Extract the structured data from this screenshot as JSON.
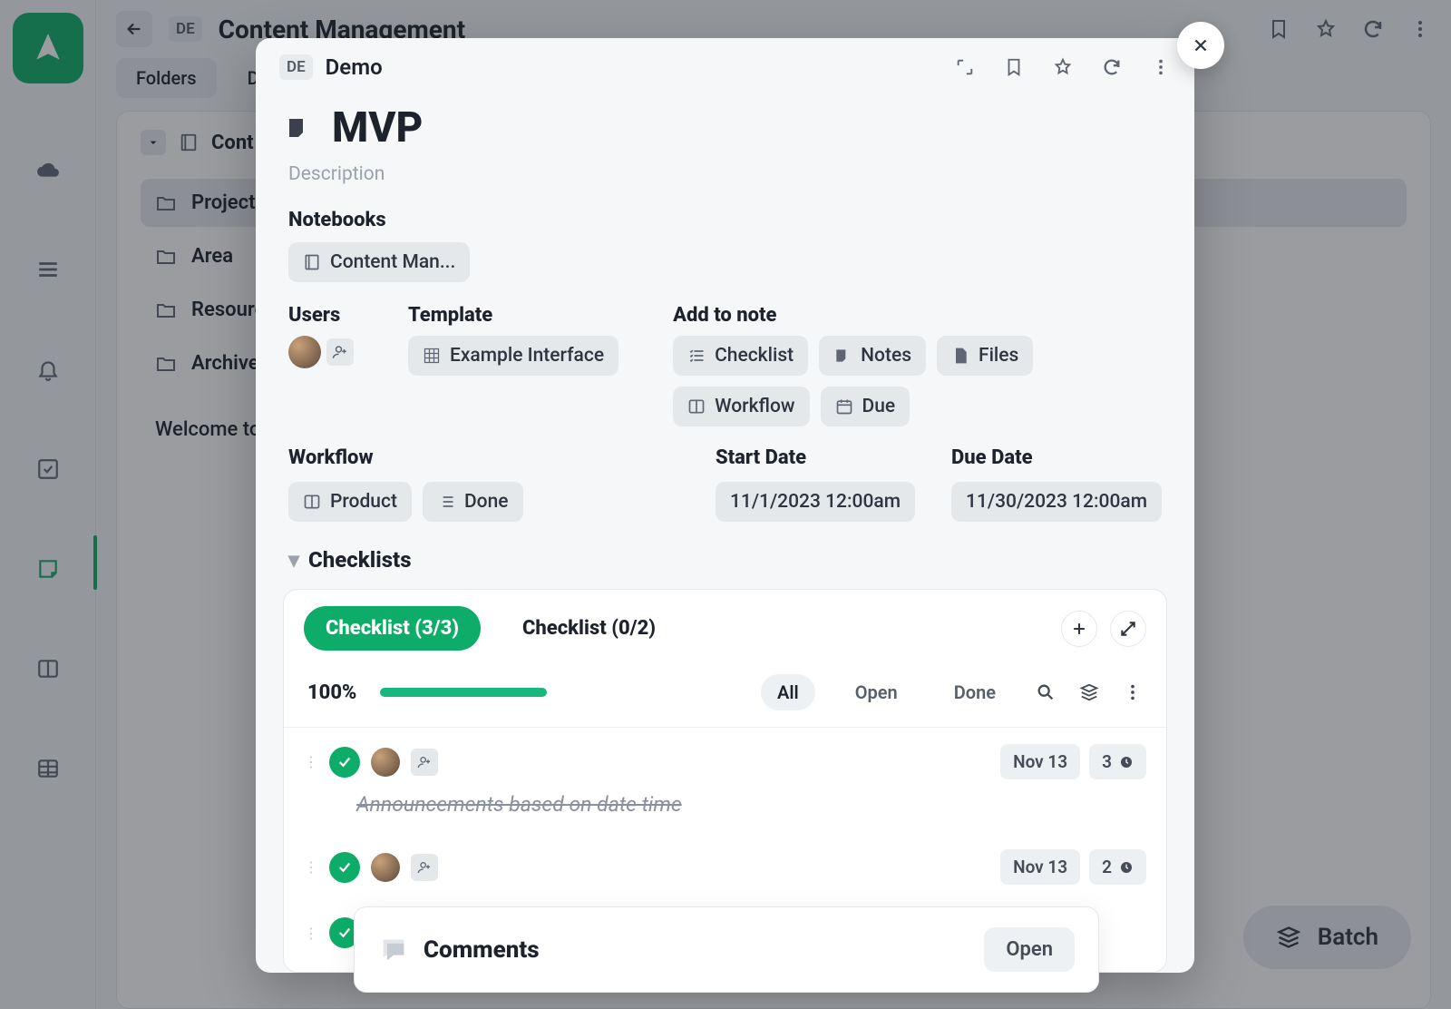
{
  "workspace_tag": "DE",
  "page_title": "Content Management",
  "tabs": {
    "folders": "Folders",
    "data": "Da"
  },
  "breadcrumb": "Cont",
  "sidebar_nav": {
    "projects": "Projects",
    "area": "Area",
    "resources": "Resourc",
    "archive": "Archive"
  },
  "welcome": "Welcome to",
  "batch_label": "Batch",
  "modal": {
    "workspace_tag": "DE",
    "workspace_name": "Demo",
    "title": "MVP",
    "description_placeholder": "Description",
    "labels": {
      "notebooks": "Notebooks",
      "users": "Users",
      "template": "Template",
      "add_to_note": "Add to note",
      "workflow": "Workflow",
      "start_date": "Start Date",
      "due_date": "Due Date",
      "checklists": "Checklists"
    },
    "notebook_chip": "Content Man...",
    "template_chip": "Example Interface",
    "add_chips": {
      "checklist": "Checklist",
      "notes": "Notes",
      "files": "Files",
      "workflow": "Workflow",
      "due": "Due"
    },
    "workflow_chips": {
      "board": "Product",
      "status": "Done"
    },
    "start_date": "11/1/2023 12:00am",
    "due_date": "11/30/2023 12:00am",
    "checklist_tabs": {
      "a": "Checklist (3/3)",
      "b": "Checklist (0/2)"
    },
    "progress_label": "100%",
    "progress_pct": 100,
    "filters": {
      "all": "All",
      "open": "Open",
      "done": "Done"
    },
    "items": [
      {
        "text": "Announcements based on date time",
        "date": "Nov 13",
        "count": "3"
      },
      {
        "text": "",
        "date": "Nov 13",
        "count": "2"
      }
    ],
    "comments": {
      "title": "Comments",
      "open": "Open"
    }
  }
}
